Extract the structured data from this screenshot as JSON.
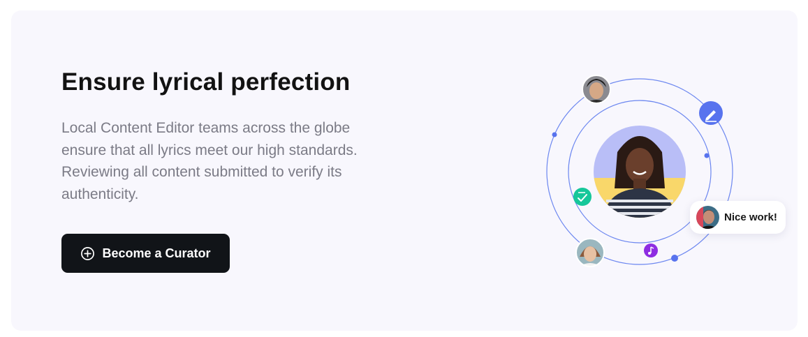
{
  "hero": {
    "title": "Ensure lyrical perfection",
    "description": "Local Content Editor teams across the globe ensure that all lyrics meet our high standards. Reviewing all content submitted to verify its authenticity.",
    "cta_label": "Become a Curator",
    "cta_icon": "plus-circle-icon"
  },
  "illustration": {
    "bubble_text": "Nice work!",
    "icons": [
      "pencil-icon",
      "check-list-icon",
      "music-note-icon"
    ],
    "colors": {
      "orbit": "#6b86f0",
      "pencil_badge": "#5873ee",
      "check_badge": "#16c79a",
      "music_badge": "#8e2de2"
    }
  }
}
